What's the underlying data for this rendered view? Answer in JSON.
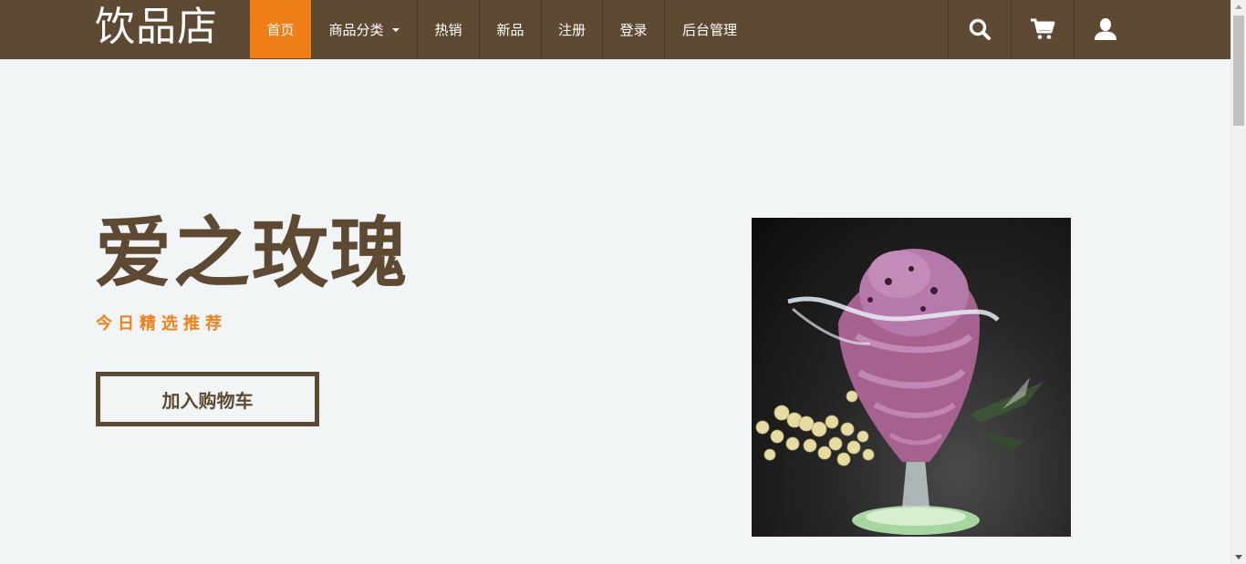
{
  "brand": "饮品店",
  "nav": {
    "items": [
      {
        "label": "首页",
        "active": true
      },
      {
        "label": "商品分类",
        "dropdown": true
      },
      {
        "label": "热销"
      },
      {
        "label": "新品"
      },
      {
        "label": "注册"
      },
      {
        "label": "登录"
      },
      {
        "label": "后台管理"
      }
    ],
    "icons": [
      "search-icon",
      "cart-icon",
      "user-icon"
    ]
  },
  "hero": {
    "title": "爱之玫瑰",
    "subtitle": "今日精选推荐",
    "button_label": "加入购物车"
  },
  "colors": {
    "navbar": "#5e4933",
    "accent": "#f07f17",
    "background": "#f2f5f6",
    "title": "#5e4933"
  }
}
